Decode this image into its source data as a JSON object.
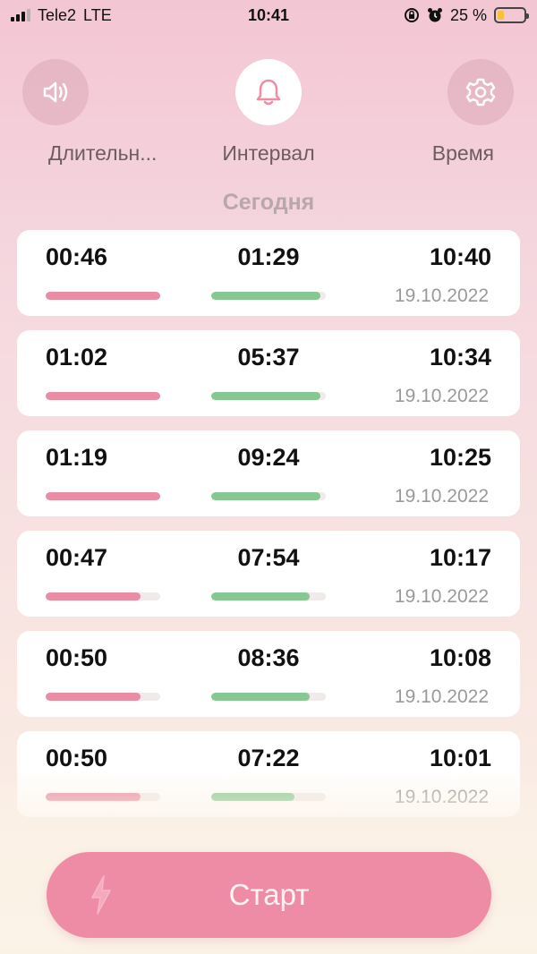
{
  "status_bar": {
    "carrier": "Tele2",
    "network": "LTE",
    "time": "10:41",
    "battery_percent": "25 %",
    "battery_level": 0.25,
    "icons": [
      "signal-icon",
      "rotation-lock-icon",
      "alarm-icon",
      "battery-icon"
    ]
  },
  "nav": {
    "items": [
      {
        "label": "Длительн...",
        "icon": "speaker-icon",
        "active": false
      },
      {
        "label": "Интервал",
        "icon": "bell-icon",
        "active": true
      },
      {
        "label": "Время",
        "icon": "gear-icon",
        "active": false
      }
    ]
  },
  "section_title": "Сегодня",
  "entries": [
    {
      "duration": "00:46",
      "interval": "01:29",
      "time": "10:40",
      "date": "19.10.2022",
      "duration_level": 1.0,
      "interval_level": 0.95
    },
    {
      "duration": "01:02",
      "interval": "05:37",
      "time": "10:34",
      "date": "19.10.2022",
      "duration_level": 1.0,
      "interval_level": 0.95
    },
    {
      "duration": "01:19",
      "interval": "09:24",
      "time": "10:25",
      "date": "19.10.2022",
      "duration_level": 1.0,
      "interval_level": 0.95
    },
    {
      "duration": "00:47",
      "interval": "07:54",
      "time": "10:17",
      "date": "19.10.2022",
      "duration_level": 0.83,
      "interval_level": 0.86
    },
    {
      "duration": "00:50",
      "interval": "08:36",
      "time": "10:08",
      "date": "19.10.2022",
      "duration_level": 0.83,
      "interval_level": 0.86
    },
    {
      "duration": "00:50",
      "interval": "07:22",
      "time": "10:01",
      "date": "19.10.2022",
      "duration_level": 0.83,
      "interval_level": 0.73
    }
  ],
  "start_button": {
    "label": "Старт",
    "icon": "lightning-icon"
  },
  "colors": {
    "accent": "#ef8ca5",
    "duration_bar": "#e98ca4",
    "interval_bar": "#86c891",
    "card": "#ffffff"
  }
}
